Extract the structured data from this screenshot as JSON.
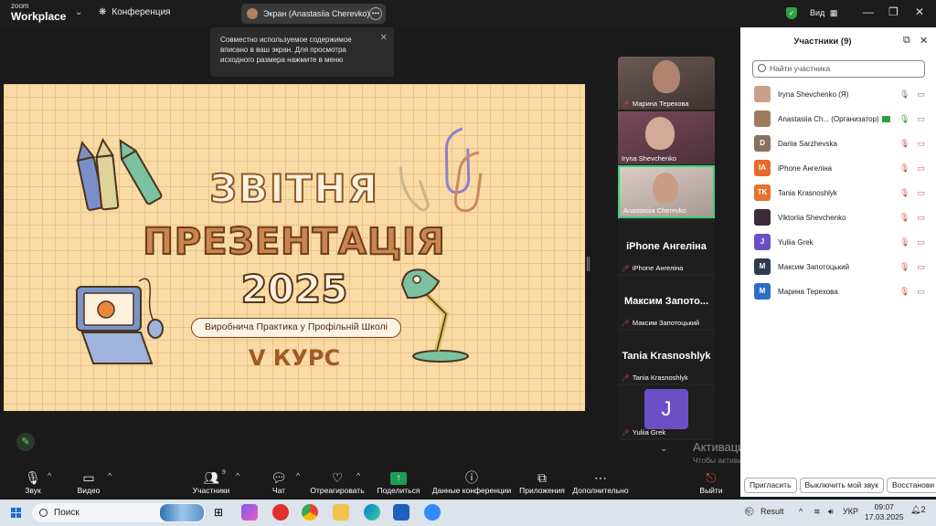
{
  "topbar": {
    "logo_small": "zoom",
    "logo_big": "Workplace",
    "meeting_label": "Конференция",
    "share_pill": "Экран (Anastasiia Cherevko)",
    "view_label": "Вид",
    "win_min": "—",
    "win_restore": "❐",
    "win_close": "✕"
  },
  "tooltip": {
    "text": "Совместно используемое содержимое вписано в ваш экран. Для просмотра исходного размера нажмите в меню"
  },
  "slide": {
    "title1": "ЗВІТНЯ",
    "title2": "ПРЕЗЕНТАЦІЯ",
    "title3": "2025",
    "subtitle": "Виробнича Практика у Профільній Школі",
    "course": "V КУРС"
  },
  "strip": {
    "tiles": [
      {
        "label": "Марина Терехова"
      },
      {
        "label": "Iryna Shevchenko"
      },
      {
        "label": "Anastasiia Cherevko"
      },
      {
        "big": "iPhone Ангеліна",
        "label": "iPhone Ангеліна"
      },
      {
        "big": "Максим Запото...",
        "label": "Максим Запотоцький"
      },
      {
        "big": "Tania Krasnoshlyk",
        "label": "Tania Krasnoshlyk"
      },
      {
        "avatar": "J",
        "label": "Yuliia Grek"
      }
    ]
  },
  "watermark": {
    "title": "Активация Windows",
    "text": "Чтобы активировать Windows, перейдите в раздел \"Параметры\"."
  },
  "participants": {
    "title": "Участники (9)",
    "search_placeholder": "Найти участника",
    "list": [
      {
        "initial": "",
        "name": "Iryna Shevchenko (Я)",
        "color": "#c9a08a",
        "mic": "on",
        "cam": "on"
      },
      {
        "initial": "",
        "name": "Anastasiia Ch... (Организатор)",
        "color": "#a07a60",
        "mic": "on",
        "cam": "on",
        "host": true
      },
      {
        "initial": "D",
        "name": "Dariia Sarzhevska",
        "color": "#8a7060",
        "mic": "off",
        "cam": "off"
      },
      {
        "initial": "IA",
        "name": "iPhone Ангеліна",
        "color": "#e86a2a",
        "mic": "off",
        "cam": "off"
      },
      {
        "initial": "TK",
        "name": "Tania Krasnoshlyk",
        "color": "#e8712a",
        "mic": "off",
        "cam": "off"
      },
      {
        "initial": "",
        "name": "Viktoriia Shevchenko",
        "color": "#3a2a3a",
        "mic": "off",
        "cam": "off"
      },
      {
        "initial": "J",
        "name": "Yuliia Grek",
        "color": "#6b4fc4",
        "mic": "off",
        "cam": "off"
      },
      {
        "initial": "M",
        "name": "Максим Запотоцький",
        "color": "#2f3b4f",
        "mic": "off",
        "cam": "off"
      },
      {
        "initial": "M",
        "name": "Марина Терехова",
        "color": "#2a6fc4",
        "mic": "off",
        "cam": "on"
      }
    ],
    "btn_invite": "Пригласить",
    "btn_mute": "Выключить мой звук",
    "btn_restore": "Восстанови"
  },
  "toolbar": {
    "audio": "Звук",
    "video": "Видео",
    "participants": "Участники",
    "participants_count": "9",
    "chat": "Чат",
    "react": "Отреагировать",
    "share": "Поделиться",
    "info": "Данные конференции",
    "apps": "Приложения",
    "more": "Дополнительно",
    "leave": "Выйти"
  },
  "taskbar": {
    "search": "Поиск",
    "result": "Result",
    "lang": "УКР",
    "time": "09:07",
    "date": "17.03.2025",
    "notif_count": "2"
  },
  "colors": {
    "slide_bg": "#fbdba5",
    "share_green": "#1f9d55",
    "active_border": "#3ad07a",
    "mic_off_red": "#d9534f"
  }
}
